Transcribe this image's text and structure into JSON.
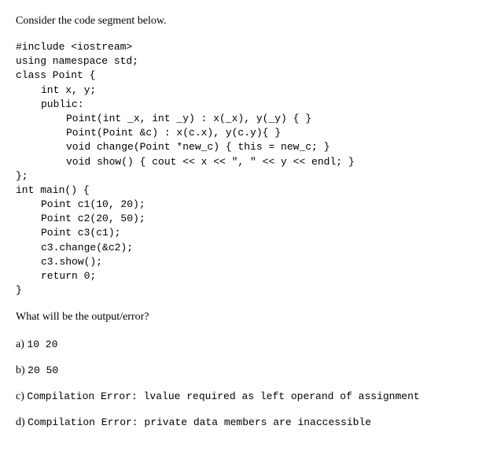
{
  "question": {
    "intro": "Consider the code segment below.",
    "prompt": "What will be the output/error?"
  },
  "code": {
    "lines": [
      {
        "text": "#include <iostream>",
        "indent": 0
      },
      {
        "text": "using namespace std;",
        "indent": 0
      },
      {
        "text": "class Point {",
        "indent": 0
      },
      {
        "text": "int x, y;",
        "indent": 1
      },
      {
        "text": "public:",
        "indent": 1
      },
      {
        "text": "Point(int _x, int _y) : x(_x), y(_y) { }",
        "indent": 2
      },
      {
        "text": "Point(Point &c) : x(c.x), y(c.y){ }",
        "indent": 2
      },
      {
        "text": "void change(Point *new_c) { this = new_c; }",
        "indent": 2
      },
      {
        "text": "void show() { cout << x << \", \" << y << endl; }",
        "indent": 2
      },
      {
        "text": "};",
        "indent": 0
      },
      {
        "text": "int main() {",
        "indent": 0
      },
      {
        "text": "Point c1(10, 20);",
        "indent": 1
      },
      {
        "text": "Point c2(20, 50);",
        "indent": 1
      },
      {
        "text": "Point c3(c1);",
        "indent": 1
      },
      {
        "text": "c3.change(&c2);",
        "indent": 1
      },
      {
        "text": "c3.show();",
        "indent": 1
      },
      {
        "text": "return 0;",
        "indent": 1
      },
      {
        "text": "}",
        "indent": 0
      }
    ]
  },
  "options": [
    {
      "label": "a)",
      "text": "10 20",
      "type": "mono"
    },
    {
      "label": "b)",
      "text": "20 50",
      "type": "mono"
    },
    {
      "label": "c)",
      "prefix": "Compilation Error:",
      "suffix": "lvalue required as left operand of assignment",
      "type": "mixed"
    },
    {
      "label": "d)",
      "prefix": "Compilation Error:",
      "suffix": "private data members are inaccessible",
      "type": "mixed"
    }
  ]
}
